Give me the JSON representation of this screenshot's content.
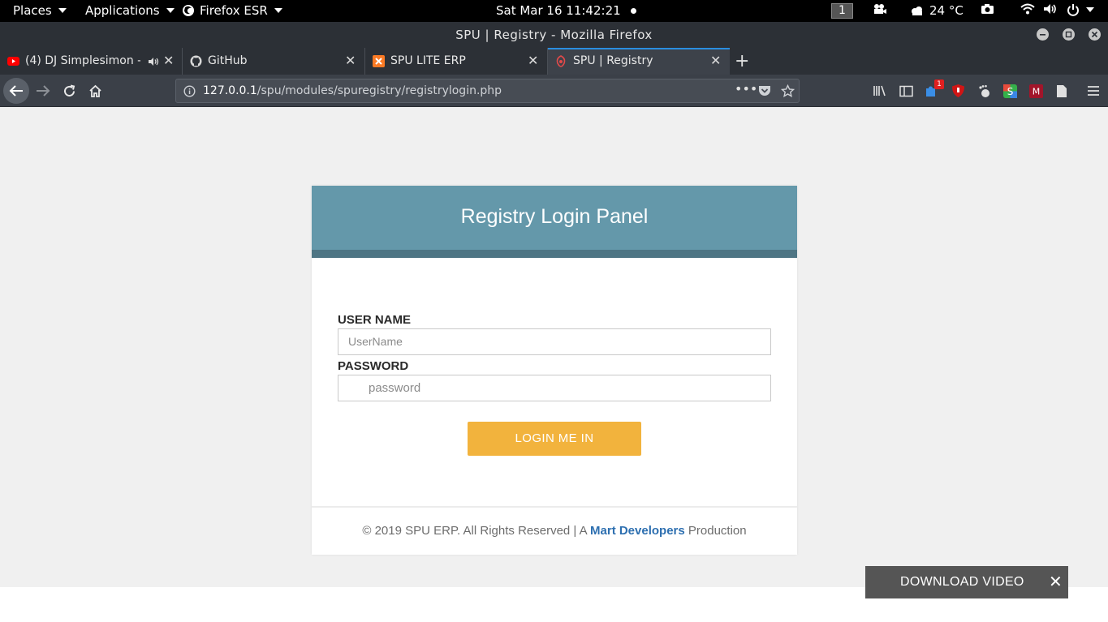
{
  "topbar": {
    "places": "Places",
    "applications": "Applications",
    "firefox": "Firefox ESR",
    "clock": "Sat Mar 16  11:42:21",
    "workspace": "1",
    "weather": "24 °C"
  },
  "window": {
    "title": "SPU | Registry - Mozilla Firefox"
  },
  "tabs": [
    {
      "label": "(4) DJ Simplesimon -",
      "icon": "youtube-icon",
      "audio": true
    },
    {
      "label": "GitHub",
      "icon": "github-icon"
    },
    {
      "label": "SPU LITE ERP",
      "icon": "xampp-icon"
    },
    {
      "label": "SPU | Registry",
      "icon": "spu-icon",
      "active": true
    }
  ],
  "nav": {
    "url_host": "127.0.0.1",
    "url_path": "/spu/modules/spuregistry/registrylogin.php",
    "badge": "1"
  },
  "login": {
    "title": "Registry Login Panel",
    "username_label": "USER NAME",
    "username_placeholder": "UserName",
    "password_label": "PASSWORD",
    "password_placeholder": "password",
    "button": "LOGIN ME IN",
    "footer_pre": "© 2019 SPU ERP. All Rights Reserved | A ",
    "footer_link": "Mart Developers",
    "footer_post": " Production"
  },
  "download_bar": {
    "label": "DOWNLOAD VIDEO",
    "close": "✕"
  },
  "colors": {
    "panel_header": "#6498aa",
    "panel_strip": "#4e7584",
    "button": "#f2b33d",
    "link": "#2d6fb0"
  }
}
